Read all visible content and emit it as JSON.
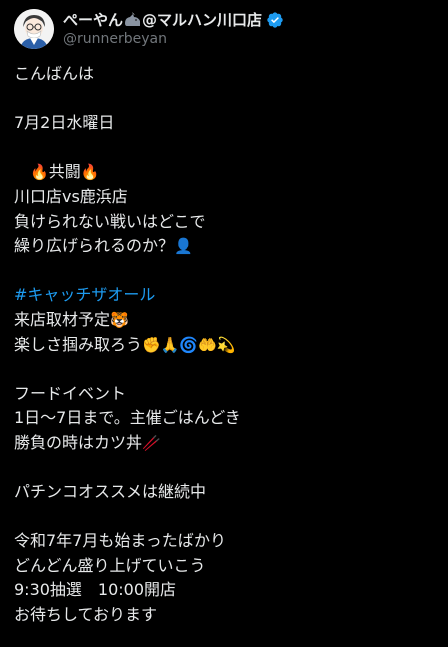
{
  "user": {
    "display_name_part1": "ぺーやん",
    "display_name_part2": "@マルハン川口店",
    "handle": "@runnerbeyan",
    "verified": true
  },
  "post": {
    "lines": [
      "こんばんは",
      "",
      "7月2日水曜日",
      "",
      "　🔥共闘🔥",
      "川口店vs鹿浜店",
      "負けられない戦いはどこで",
      "繰り広げられるのか？👤",
      "",
      "#キャッチザオール",
      "来店取材予定🐯",
      "楽しさ掴み取ろう✊🙏🌀🤲💫",
      "",
      "フードイベント",
      "1日〜7日まで。主催ごはんどき",
      "勝負の時はカツ丼🥢",
      "",
      "パチンコオススメは継続中",
      "",
      "令和7年7月も始まったばかり",
      "どんどん盛り上げていこう",
      "9:30抽選　10:00開店",
      "お待ちしております"
    ],
    "segments": {
      "l5_indent": "　",
      "l5_fire_a": "🔥",
      "l5_text": "共闘",
      "l5_fire_b": "🔥",
      "l8_text": "繰り広げられるのか？",
      "l8_emoji": "👤",
      "l10_hashtag": "#キャッチザオール",
      "l11_text": "来店取材予定",
      "l11_emoji": "🐯",
      "l12_text": "楽しさ掴み取ろう",
      "l12_e1": "✊",
      "l12_e2": "🙏",
      "l12_e3": "🌀",
      "l12_e4": "🤲",
      "l12_e5": "💫",
      "l16_text": "勝負の時はカツ丼",
      "l16_emoji": "🥢"
    }
  },
  "colors": {
    "background": "#000000",
    "text": "#e7e9ea",
    "muted": "#71767b",
    "link": "#1d9bf0",
    "verified": "#1d9bf0"
  },
  "icons": {
    "avatar": "avatar-illustration",
    "rhino": "rhino-icon",
    "verified": "verified-badge-icon"
  }
}
